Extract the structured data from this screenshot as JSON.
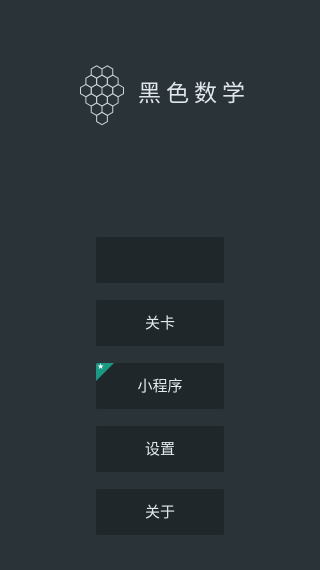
{
  "app": {
    "title": "黑色数学",
    "logo_icon": "hexagon-grid-icon"
  },
  "menu": {
    "play_label": "",
    "levels_label": "关卡",
    "mini_program_label": "小程序",
    "settings_label": "设置",
    "about_label": "关于",
    "badge_icon": "star-icon",
    "badge_symbol": "★"
  },
  "colors": {
    "background": "#2a3338",
    "button": "#1f272b",
    "text": "#e4e9eb",
    "badge": "#1a9a83"
  }
}
